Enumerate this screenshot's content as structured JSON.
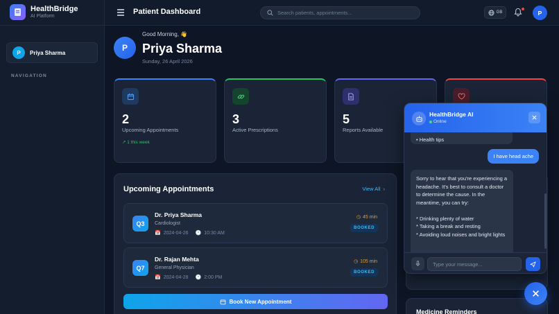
{
  "brand": {
    "name": "HealthBridge",
    "subtitle": "AI Platform"
  },
  "sidebar": {
    "user": {
      "initial": "P",
      "name": "Priya Sharma"
    },
    "nav_heading": "NAVIGATION"
  },
  "topbar": {
    "title": "Patient Dashboard",
    "search_placeholder": "Search patients, appointments...",
    "language": "GB",
    "avatar_initial": "P"
  },
  "greeting": {
    "hello": "Good Morning, 👋",
    "name": "Priya Sharma",
    "date": "Sunday, 26 April 2026",
    "avatar_initial": "P"
  },
  "stats": [
    {
      "value": "2",
      "label": "Upcoming Appointments",
      "trend": "1 this week",
      "icon": "calendar-icon",
      "color": "#3b82f6"
    },
    {
      "value": "3",
      "label": "Active Prescriptions",
      "icon": "link-icon",
      "color": "#22c55e"
    },
    {
      "value": "5",
      "label": "Reports Available",
      "icon": "document-icon",
      "color": "#6366f1"
    },
    {
      "value": "",
      "label": "",
      "icon": "heart-icon",
      "color": "#ef4444"
    }
  ],
  "appointments": {
    "title": "Upcoming Appointments",
    "view_all": "View All",
    "items": [
      {
        "token": "Q3",
        "doctor": "Dr. Priya Sharma",
        "specialty": "Cardiologist",
        "date": "2024-04-26",
        "time": "10:30 AM",
        "duration": "45 min",
        "status": "BOOKED"
      },
      {
        "token": "Q7",
        "doctor": "Dr. Rajan Mehta",
        "specialty": "General Physician",
        "date": "2024-04-28",
        "time": "2:00 PM",
        "duration": "105 min",
        "status": "BOOKED"
      }
    ],
    "book_button": "Book New Appointment"
  },
  "medicine": {
    "title": "Medicine Reminders"
  },
  "chat": {
    "bot_name": "HealthBridge AI",
    "status": "Online",
    "messages": [
      {
        "from": "bot",
        "text": "• Health tips"
      },
      {
        "from": "user",
        "text": "I have head ache"
      },
      {
        "from": "bot",
        "text": "Sorry to hear that you're experiencing a headache. It's best to consult a doctor to determine the cause. In the meantime, you can try:\n\n* Drinking plenty of water\n* Taking a break and resting\n* Avoiding loud noises and bright lights"
      }
    ],
    "input_placeholder": "Type your message..."
  },
  "colors": {
    "accent": "#3b82f6",
    "background": "#0e1626",
    "booked": "#38bdf8",
    "duration": "#f59e0b"
  }
}
